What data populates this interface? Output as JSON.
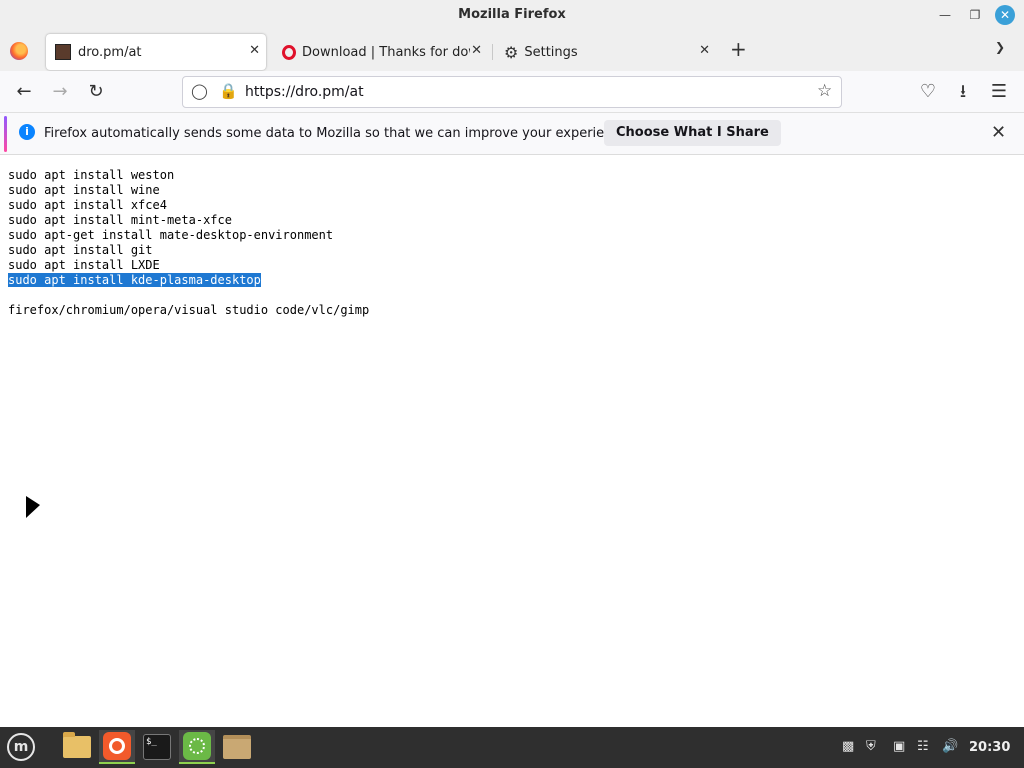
{
  "window": {
    "title": "Mozilla Firefox"
  },
  "tabs": [
    {
      "label": "dro.pm/at",
      "active": true
    },
    {
      "label": "Download | Thanks for dow",
      "active": false
    },
    {
      "label": "Settings",
      "active": false
    }
  ],
  "navbar": {
    "url": "https://dro.pm/at"
  },
  "infobar": {
    "message": "Firefox automatically sends some data to Mozilla so that we can improve your experience.",
    "button": "Choose What I Share"
  },
  "content": {
    "lines": [
      "sudo apt install weston",
      "sudo apt install wine",
      "sudo apt install xfce4",
      "sudo apt install mint-meta-xfce",
      "sudo apt-get install mate-desktop-environment",
      "sudo apt install git",
      "sudo apt install LXDE",
      "sudo apt install kde-plasma-desktop",
      "",
      "firefox/chromium/opera/visual studio code/vlc/gimp"
    ],
    "selected_line": "sudo apt install kde-plasma-desktop"
  },
  "taskbar": {
    "apps": [
      "menu-icon",
      "files-icon",
      "firefox-icon",
      "terminal-icon",
      "calculator-icon",
      "archive-icon"
    ],
    "clock": "20:30"
  },
  "colors": {
    "selection": "#1e78d2",
    "accent": "#8fd14f"
  }
}
